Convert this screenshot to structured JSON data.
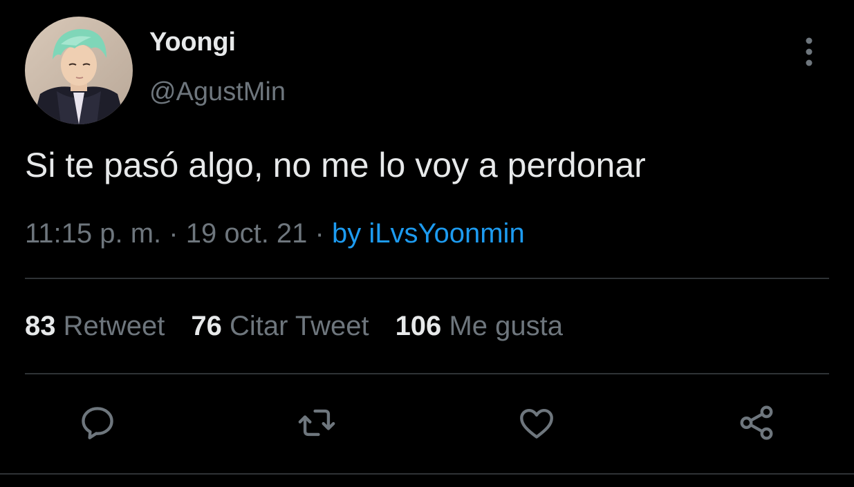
{
  "user": {
    "display_name": "Yoongi",
    "handle": "@AgustMin",
    "avatar_icon": "profile-photo"
  },
  "tweet": {
    "text": "Si te pasó algo, no me lo voy a perdonar",
    "time": "11:15 p. m.",
    "date": "19 oct. 21",
    "separator": "·",
    "source": "by iLvsYoonmin"
  },
  "stats": [
    {
      "count": "83",
      "label": "Retweet"
    },
    {
      "count": "76",
      "label": "Citar Tweet"
    },
    {
      "count": "106",
      "label": "Me gusta"
    }
  ],
  "actions": {
    "reply_icon": "reply-icon",
    "retweet_icon": "retweet-icon",
    "like_icon": "heart-icon",
    "share_icon": "share-icon"
  },
  "colors": {
    "background": "#000000",
    "primary_text": "#e7e9ea",
    "secondary_text": "#6e767d",
    "link": "#1d9bf0",
    "divider": "#2f3336"
  }
}
